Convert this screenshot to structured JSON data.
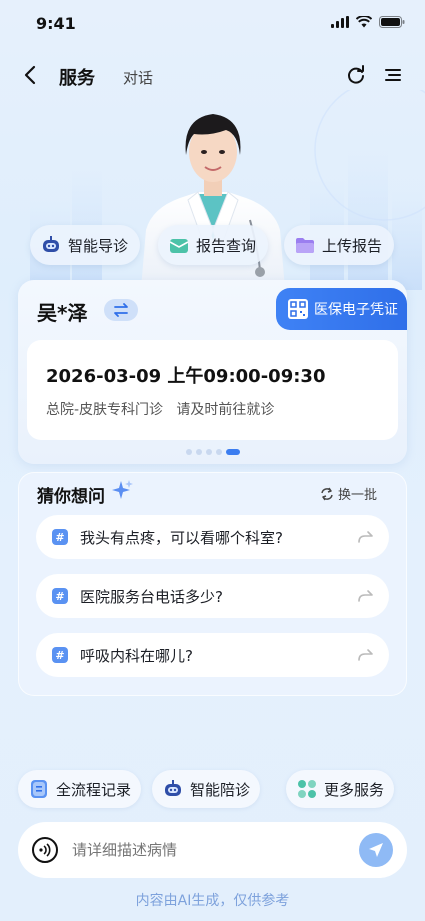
{
  "status": {
    "time": "9:41"
  },
  "header": {
    "active_tab": "服务",
    "other_tab": "对话"
  },
  "quick_actions": [
    {
      "label": "智能导诊",
      "icon": "robot-icon"
    },
    {
      "label": "报告查询",
      "icon": "report-envelope-icon"
    },
    {
      "label": "上传报告",
      "icon": "folder-icon"
    }
  ],
  "patient": {
    "name": "吴*泽",
    "insurance_label": "医保电子凭证",
    "appointment_time": "2026-03-09 上午09:00-09:30",
    "appointment_desc": "总院-皮肤专科门诊   请及时前往就诊"
  },
  "pager": {
    "count": 5,
    "active": 5
  },
  "guess": {
    "title": "猜你想问",
    "refresh_label": "换一批",
    "questions": [
      "我头有点疼，可以看哪个科室?",
      "医院服务台电话多少?",
      "呼吸内科在哪儿?"
    ]
  },
  "bottom_actions": [
    {
      "label": "全流程记录",
      "icon": "record-icon"
    },
    {
      "label": "智能陪诊",
      "icon": "robot-icon"
    },
    {
      "label": "更多服务",
      "icon": "grid-icon"
    }
  ],
  "input": {
    "placeholder": "请详细描述病情"
  },
  "disclaimer": "内容由AI生成，仅供参考",
  "colors": {
    "accent": "#3b7df0",
    "background": "#e3effc"
  }
}
